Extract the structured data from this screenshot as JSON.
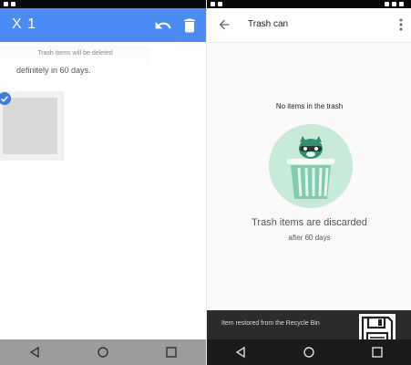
{
  "left": {
    "selection_count": "X 1",
    "info_line1": "Trash items will be deleted",
    "info_line2": "definitely in 60 days.",
    "colors": {
      "appbar": "#4a8bf5",
      "check": "#3b7de0"
    },
    "icons": [
      "undo-icon",
      "trash-icon",
      "check-circle-icon",
      "nav-back-icon",
      "nav-home-icon",
      "nav-recents-icon"
    ]
  },
  "right": {
    "title": "Trash can",
    "empty_title": "No items in the trash",
    "empty_message": "Trash items are discarded",
    "empty_sub": "after 60 days",
    "snackbar": "Item restored from the Recycle Bin",
    "colors": {
      "illustration_circle": "#c8ead9",
      "snackbar": "#2b2b2b"
    },
    "icons": [
      "back-arrow-icon",
      "overflow-menu-icon",
      "raccoon-trash-illustration",
      "floppy-disk-icon",
      "nav-back-icon",
      "nav-home-icon",
      "nav-recents-icon"
    ]
  }
}
